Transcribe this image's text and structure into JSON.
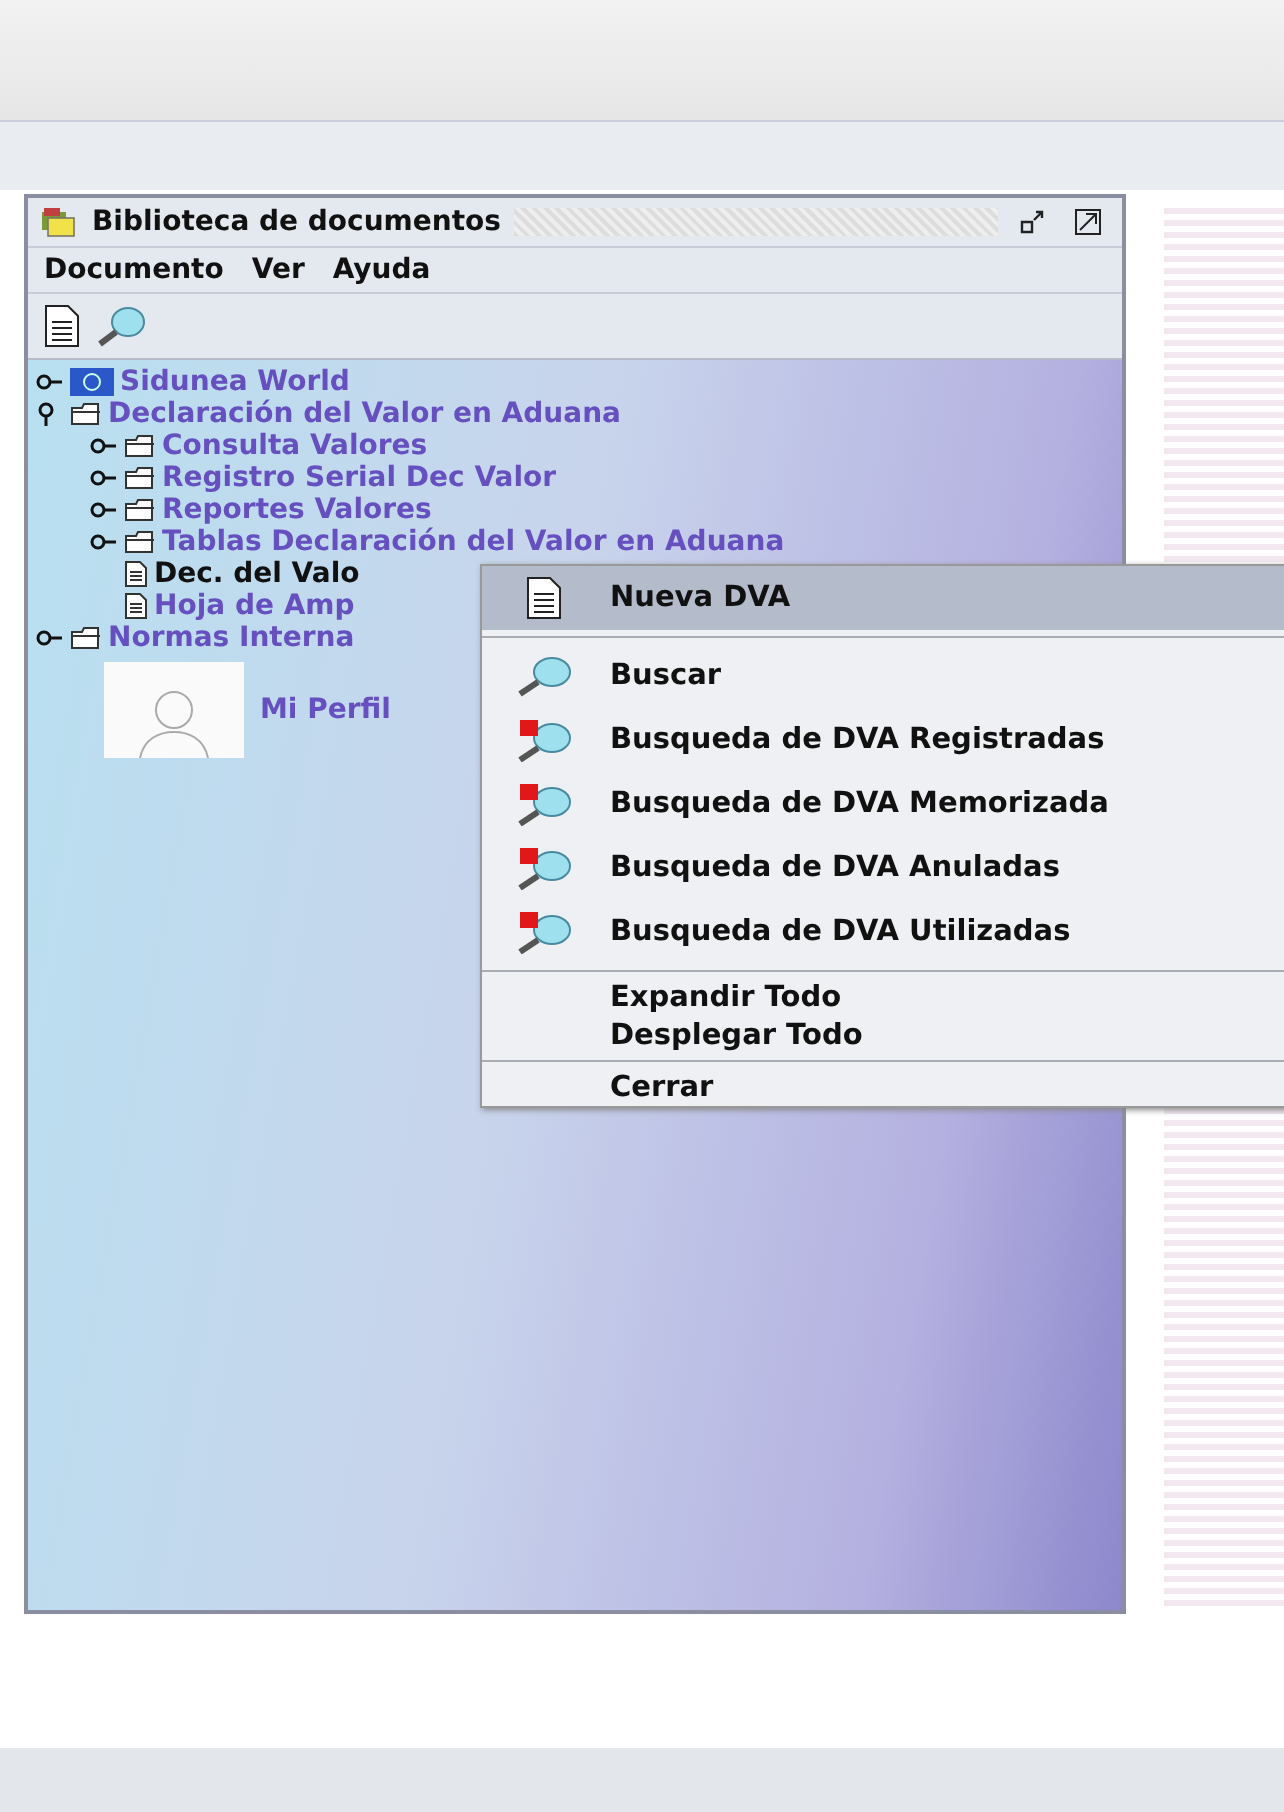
{
  "window": {
    "title": "Biblioteca de documentos"
  },
  "menu_bar": [
    "Documento",
    "Ver",
    "Ayuda"
  ],
  "toolbar": [
    {
      "kind": "document"
    },
    {
      "kind": "search"
    }
  ],
  "tree": [
    {
      "label": "Sidunea World",
      "kind": "flag",
      "expanded": false,
      "selected": false
    },
    {
      "label": "Declaración del Valor en Aduana",
      "kind": "folder",
      "expanded": true,
      "selected": false,
      "children": [
        {
          "label": "Consulta Valores",
          "kind": "folder",
          "expanded": false,
          "selected": false
        },
        {
          "label": "Registro Serial Dec Valor",
          "kind": "folder",
          "expanded": false,
          "selected": false
        },
        {
          "label": "Reportes Valores",
          "kind": "folder",
          "expanded": false,
          "selected": false
        },
        {
          "label": "Tablas Declaración del Valor en Aduana",
          "kind": "folder",
          "expanded": false,
          "selected": false
        },
        {
          "label": "Dec. del Valo",
          "kind": "document",
          "selected": true
        },
        {
          "label": "Hoja de Amp",
          "kind": "document",
          "selected": false
        }
      ]
    },
    {
      "label": "Normas Interna",
      "kind": "folder",
      "expanded": false,
      "selected": false
    },
    {
      "label": "Mi Perfil",
      "kind": "profile",
      "selected": false
    }
  ],
  "context_menu": [
    [
      {
        "label": "Nueva DVA",
        "kind": "document",
        "selected": true
      }
    ],
    [
      {
        "label": "Buscar",
        "kind": "search",
        "selected": false
      },
      {
        "label": "Busqueda de DVA Registradas",
        "kind": "flag-search",
        "selected": false
      },
      {
        "label": "Busqueda de DVA Memorizada",
        "kind": "flag-search",
        "selected": false
      },
      {
        "label": "Busqueda de DVA Anuladas",
        "kind": "flag-search",
        "selected": false
      },
      {
        "label": "Busqueda de DVA Utilizadas",
        "kind": "flag-search",
        "selected": false
      }
    ],
    [
      {
        "label": "Expandir Todo",
        "kind": "plain",
        "selected": false
      },
      {
        "label": "Desplegar Todo",
        "kind": "plain",
        "selected": false
      }
    ],
    [
      {
        "label": "Cerrar",
        "kind": "plain",
        "selected": false
      }
    ]
  ]
}
